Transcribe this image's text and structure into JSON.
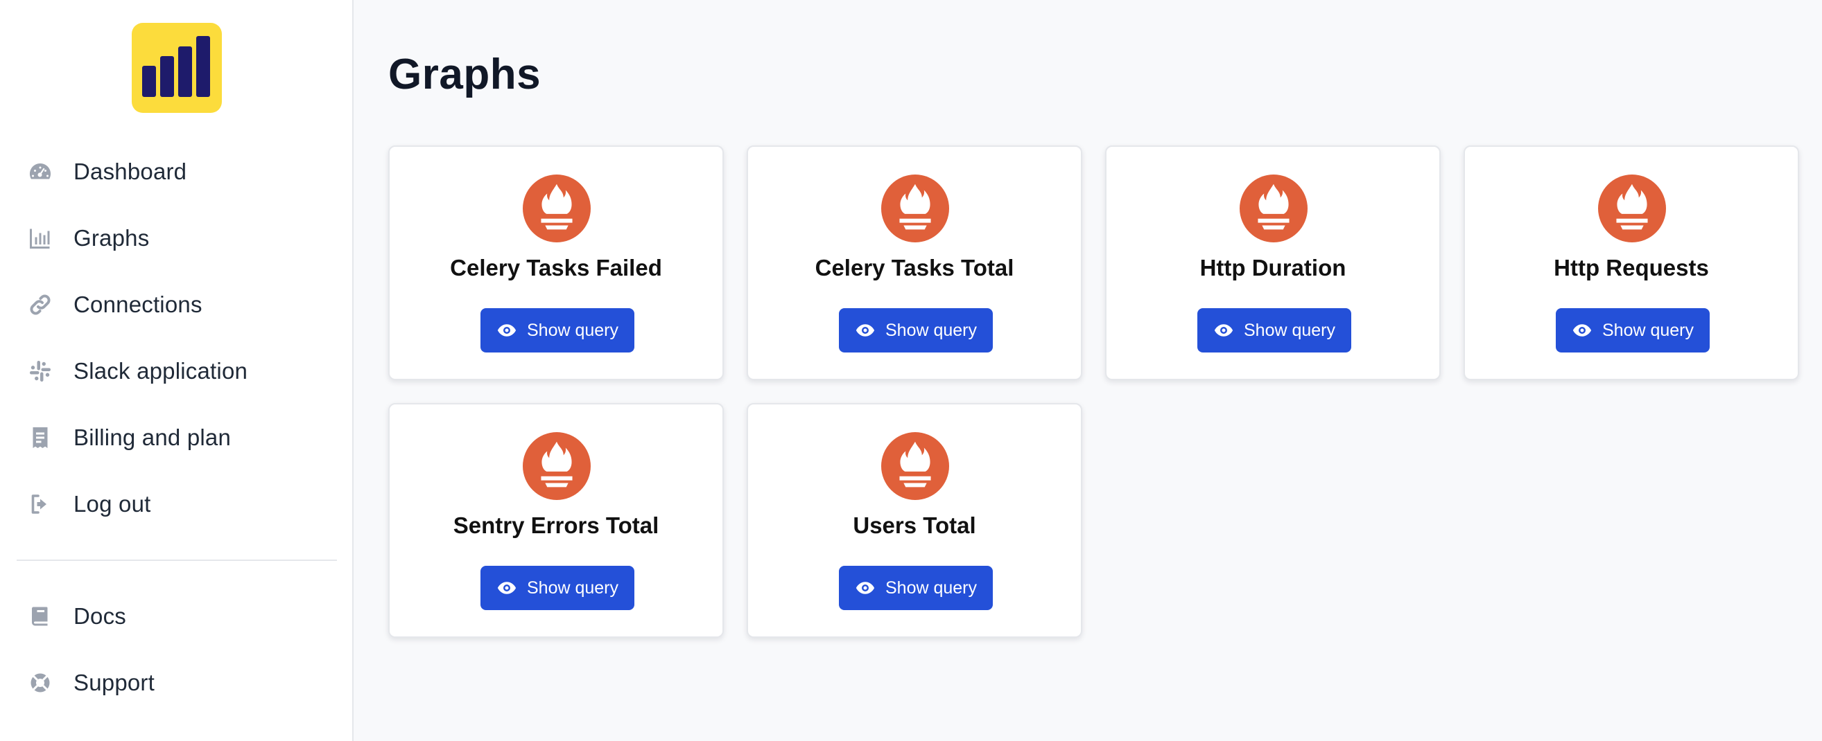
{
  "brand": {
    "logo_icon": "bar-chart-logo",
    "logo_bg": "#fcdc3c",
    "logo_fg": "#1e1b6b"
  },
  "sidebar": {
    "items": [
      {
        "label": "Dashboard",
        "icon": "gauge-icon"
      },
      {
        "label": "Graphs",
        "icon": "bar-chart-icon"
      },
      {
        "label": "Connections",
        "icon": "link-icon"
      },
      {
        "label": "Slack application",
        "icon": "slack-icon"
      },
      {
        "label": "Billing and plan",
        "icon": "receipt-icon"
      },
      {
        "label": "Log out",
        "icon": "logout-icon"
      }
    ],
    "secondary": [
      {
        "label": "Docs",
        "icon": "book-icon"
      },
      {
        "label": "Support",
        "icon": "lifebuoy-icon"
      }
    ]
  },
  "main": {
    "title": "Graphs",
    "cards": [
      {
        "title": "Celery Tasks Failed",
        "button": "Show query",
        "icon": "prometheus-icon"
      },
      {
        "title": "Celery Tasks Total",
        "button": "Show query",
        "icon": "prometheus-icon"
      },
      {
        "title": "Http Duration",
        "button": "Show query",
        "icon": "prometheus-icon"
      },
      {
        "title": "Http Requests",
        "button": "Show query",
        "icon": "prometheus-icon"
      },
      {
        "title": "Sentry Errors Total",
        "button": "Show query",
        "icon": "prometheus-icon"
      },
      {
        "title": "Users Total",
        "button": "Show query",
        "icon": "prometheus-icon"
      }
    ]
  },
  "colors": {
    "accent": "#2450d8",
    "prometheus": "#e0603a",
    "icon_gray": "#9ca3af"
  }
}
